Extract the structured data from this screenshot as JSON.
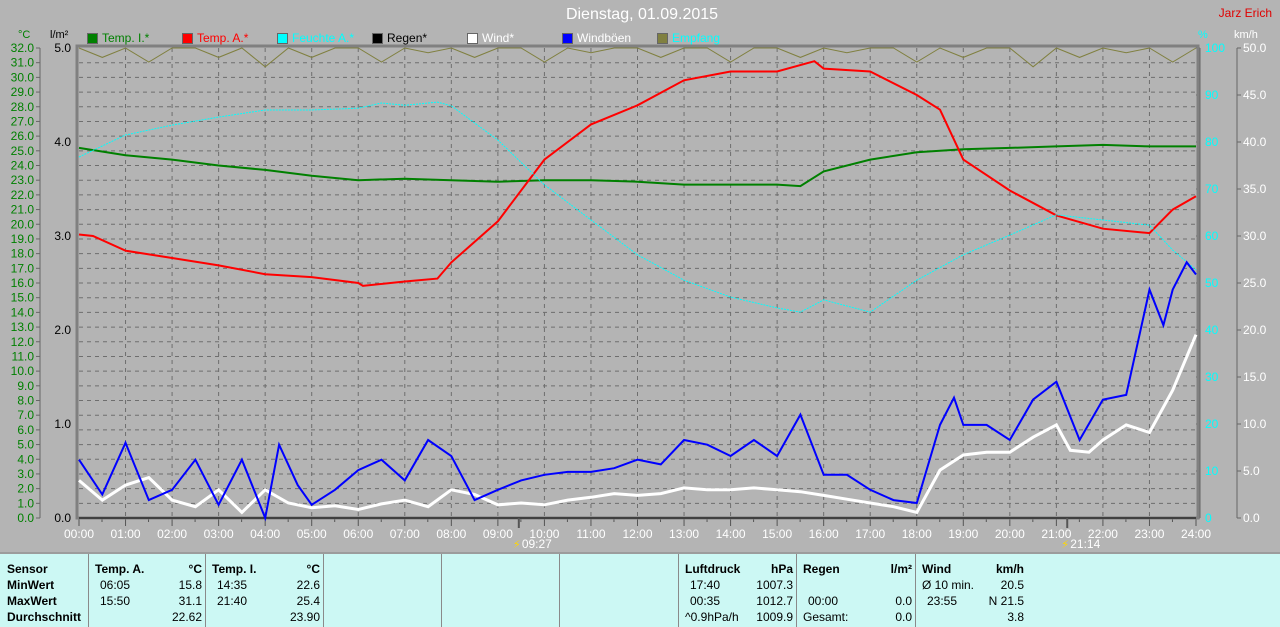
{
  "header": {
    "title": "Dienstag, 01.09.2015",
    "author": "Jarz Erich"
  },
  "axes": {
    "left_unit": "°C",
    "rain_unit": "l/m²",
    "hum_unit": "%",
    "wind_unit": "km/h"
  },
  "legend": [
    {
      "label": "Temp. I.*",
      "color": "#008000"
    },
    {
      "label": "Temp. A.*",
      "color": "#ff0000"
    },
    {
      "label": "Feuchte A.*",
      "color": "#00ffff"
    },
    {
      "label": "Regen*",
      "color": "#000000"
    },
    {
      "label": "Wind*",
      "color": "#ffffff"
    },
    {
      "label": "Windböen",
      "color": "#0000ff"
    },
    {
      "label": "Empfang",
      "color": "#808040"
    }
  ],
  "markers": {
    "sunrise": "09:27",
    "sunset": "21:14"
  },
  "chart_data": {
    "type": "line",
    "title": "Dienstag, 01.09.2015",
    "x_unit": "hours",
    "xlim": [
      0,
      24
    ],
    "x_ticks": [
      "00:00",
      "01:00",
      "02:00",
      "03:00",
      "04:00",
      "05:00",
      "06:00",
      "07:00",
      "08:00",
      "09:00",
      "10:00",
      "11:00",
      "12:00",
      "13:00",
      "14:00",
      "15:00",
      "16:00",
      "17:00",
      "18:00",
      "19:00",
      "20:00",
      "21:00",
      "22:00",
      "23:00",
      "24:00"
    ],
    "y_temp": {
      "unit": "°C",
      "lim": [
        0,
        32
      ],
      "step": 1
    },
    "y_rain": {
      "unit": "l/m²",
      "lim": [
        0,
        5
      ],
      "ticks": [
        "0.0",
        "1.0",
        "2.0",
        "3.0",
        "4.0",
        "5.0"
      ]
    },
    "y_hum": {
      "unit": "%",
      "lim": [
        0,
        100
      ],
      "step": 10
    },
    "y_wind": {
      "unit": "km/h",
      "lim": [
        0,
        50
      ],
      "step": 5
    },
    "series": [
      {
        "name": "Temp. I.*",
        "axis": "temp",
        "color": "#008000",
        "x": [
          0,
          1,
          2,
          3,
          4,
          5,
          6,
          7,
          8,
          9,
          10,
          11,
          12,
          13,
          14,
          15,
          15.5,
          16,
          17,
          18,
          19,
          20,
          21,
          22,
          23,
          24
        ],
        "y": [
          25.2,
          24.7,
          24.4,
          24.0,
          23.7,
          23.3,
          23.0,
          23.1,
          23.0,
          22.9,
          23.0,
          23.0,
          22.9,
          22.7,
          22.7,
          22.7,
          22.6,
          23.6,
          24.4,
          24.9,
          25.1,
          25.2,
          25.3,
          25.4,
          25.3,
          25.3
        ]
      },
      {
        "name": "Temp. A.*",
        "axis": "temp",
        "color": "#ff0000",
        "x": [
          0,
          0.3,
          1,
          2,
          3,
          4,
          5,
          6,
          6.1,
          7,
          7.7,
          8,
          9,
          10,
          11,
          12,
          13,
          14,
          15,
          15.8,
          16,
          17,
          18,
          18.5,
          19,
          20,
          21,
          22,
          23,
          23.5,
          24
        ],
        "y": [
          19.3,
          19.2,
          18.2,
          17.7,
          17.2,
          16.6,
          16.4,
          16.0,
          15.8,
          16.1,
          16.3,
          17.4,
          20.2,
          24.4,
          26.8,
          28.1,
          29.8,
          30.4,
          30.4,
          31.1,
          30.6,
          30.4,
          28.8,
          27.8,
          24.4,
          22.3,
          20.6,
          19.7,
          19.4,
          21.0,
          21.9
        ]
      },
      {
        "name": "Feuchte A.*",
        "axis": "hum",
        "color": "#00ffff",
        "x": [
          0,
          1,
          2,
          3,
          4,
          5,
          6,
          6.5,
          7,
          7.7,
          8,
          9,
          10,
          11,
          12,
          13,
          14,
          15,
          15.5,
          16,
          17,
          18,
          19,
          20,
          21,
          22,
          23,
          23.5,
          24
        ],
        "y": [
          76.8,
          81.5,
          83.6,
          85.3,
          86.8,
          86.8,
          87.2,
          88.3,
          87.8,
          88.5,
          87.7,
          80.4,
          70.9,
          63.4,
          56.0,
          50.6,
          47.0,
          44.7,
          43.8,
          46.4,
          43.8,
          50.6,
          56.0,
          60.2,
          64.5,
          63.4,
          62.3,
          57.0,
          52.8
        ]
      },
      {
        "name": "Regen*",
        "axis": "rain",
        "color": "#000000",
        "x": [
          0,
          24
        ],
        "y": [
          0,
          0
        ]
      },
      {
        "name": "Wind*",
        "axis": "wind",
        "color": "#ffffff",
        "x": [
          0,
          0.5,
          1,
          1.5,
          2,
          2.5,
          3,
          3.5,
          4,
          4.5,
          5,
          5.5,
          6,
          6.5,
          7,
          7.5,
          8,
          8.5,
          9,
          9.5,
          10,
          10.5,
          11,
          11.5,
          12,
          12.5,
          13,
          13.5,
          14,
          14.5,
          15,
          15.5,
          16,
          16.5,
          17,
          17.5,
          18,
          18.5,
          19,
          19.5,
          20,
          20.5,
          21,
          21.3,
          21.7,
          22,
          22.5,
          23,
          23.5,
          24
        ],
        "y": [
          4.0,
          1.9,
          3.5,
          4.3,
          1.9,
          1.2,
          3.0,
          0.6,
          3.0,
          1.6,
          1.1,
          1.3,
          0.9,
          1.5,
          1.9,
          1.2,
          3.0,
          2.5,
          1.4,
          1.6,
          1.4,
          1.9,
          2.2,
          2.6,
          2.4,
          2.6,
          3.2,
          3.0,
          3.0,
          3.2,
          3.0,
          2.8,
          2.4,
          2.0,
          1.6,
          1.2,
          0.6,
          5.1,
          6.7,
          7.0,
          7.0,
          8.6,
          9.9,
          7.2,
          7.0,
          8.3,
          9.9,
          9.1,
          13.6,
          19.5
        ]
      },
      {
        "name": "Windböen",
        "axis": "wind",
        "color": "#0000ff",
        "x": [
          0,
          0.5,
          1,
          1.5,
          2,
          2.5,
          3,
          3.5,
          4,
          4.3,
          4.7,
          5,
          5.5,
          6,
          6.5,
          7,
          7.5,
          8,
          8.5,
          9,
          9.5,
          10,
          10.5,
          11,
          11.5,
          12,
          12.5,
          13,
          13.5,
          14,
          14.5,
          15,
          15.5,
          16,
          16.5,
          17,
          17.5,
          18,
          18.5,
          18.8,
          19,
          19.5,
          20,
          20.5,
          21,
          21.5,
          22,
          22.5,
          23,
          23.3,
          23.5,
          23.8,
          24
        ],
        "y": [
          6.2,
          2.5,
          8.0,
          1.9,
          3.0,
          6.2,
          1.4,
          6.2,
          0.0,
          7.8,
          3.5,
          1.4,
          3.0,
          5.1,
          6.2,
          4.0,
          8.3,
          6.6,
          1.9,
          3.0,
          4.0,
          4.6,
          4.9,
          4.9,
          5.3,
          6.2,
          5.7,
          8.3,
          7.8,
          6.6,
          8.3,
          6.6,
          11.0,
          4.6,
          4.6,
          3.0,
          1.9,
          1.6,
          9.9,
          12.8,
          9.9,
          9.9,
          8.3,
          12.6,
          14.5,
          8.3,
          12.6,
          13.1,
          24.3,
          20.5,
          24.3,
          27.2,
          25.9
        ]
      },
      {
        "name": "Empfang",
        "axis": "hum",
        "color": "#808040",
        "x": [
          0,
          0.5,
          1,
          1.5,
          2,
          2.5,
          3,
          3.5,
          4,
          4.5,
          5,
          5.5,
          6,
          6.5,
          7,
          7.5,
          8,
          8.5,
          9,
          9.5,
          10,
          10.5,
          11,
          11.5,
          12,
          12.5,
          13,
          13.5,
          14,
          14.5,
          15,
          15.5,
          16,
          16.5,
          17,
          17.5,
          18,
          18.5,
          19,
          19.5,
          20,
          20.5,
          21,
          21.5,
          22,
          22.5,
          23,
          23.5,
          24
        ],
        "y": [
          100,
          98,
          100,
          97,
          100,
          100,
          98,
          100,
          96,
          100,
          98,
          100,
          100,
          97,
          100,
          99,
          100,
          98,
          100,
          100,
          97,
          100,
          99,
          100,
          100,
          98,
          100,
          100,
          97,
          100,
          100,
          98,
          100,
          99,
          100,
          100,
          97,
          100,
          98,
          100,
          100,
          96,
          100,
          98,
          100,
          99,
          100,
          97,
          100
        ]
      }
    ]
  },
  "table": {
    "sensor": {
      "header": "Sensor",
      "rows": [
        "MinWert",
        "MaxWert",
        "Durchschnitt"
      ]
    },
    "temp_a": {
      "header": "Temp. A.",
      "unit": "°C",
      "min_time": "06:05",
      "min": "15.8",
      "max_time": "15:50",
      "max": "31.1",
      "avg": "22.62"
    },
    "temp_i": {
      "header": "Temp. I.",
      "unit": "°C",
      "min_time": "14:35",
      "min": "22.6",
      "max_time": "21:40",
      "max": "25.4",
      "avg": "23.90"
    },
    "pressure": {
      "header": "Luftdruck",
      "unit": "hPa",
      "min_time": "17:40",
      "min": "1007.3",
      "max_time": "00:35",
      "max": "1012.7",
      "trend": "^0.9hPa/h",
      "avg": "1009.9"
    },
    "rain": {
      "header": "Regen",
      "unit": "l/m²",
      "time": "00:00",
      "value": "0.0",
      "total_label": "Gesamt:",
      "total": "0.0"
    },
    "wind": {
      "header": "Wind",
      "unit": "km/h",
      "avg_label": "Ø 10 min.",
      "avg": "20.5",
      "max_time": "23:55",
      "max": "N 21.5",
      "mean": "3.8"
    }
  }
}
